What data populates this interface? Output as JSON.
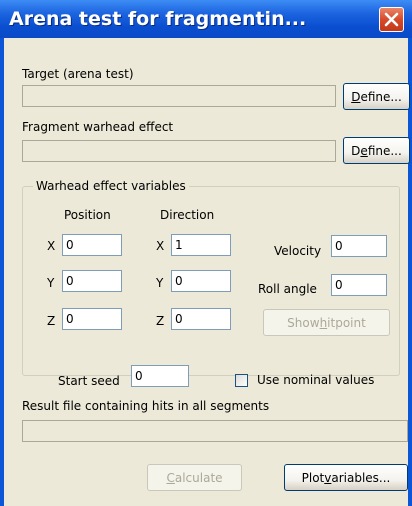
{
  "window": {
    "title": "Arena test for fragmentin...",
    "close_icon": "close-icon"
  },
  "target": {
    "label": "Target (arena test)",
    "value": "",
    "define_button": {
      "prefix": "",
      "mnemonic": "D",
      "suffix": "efine..."
    }
  },
  "fragment": {
    "label": "Fragment warhead effect",
    "value": "",
    "define_button": {
      "prefix": "D",
      "mnemonic": "e",
      "suffix": "fine..."
    }
  },
  "warhead_group": {
    "title": "Warhead effect variables",
    "position": {
      "header": "Position",
      "x_label": "X",
      "x_value": "0",
      "y_label": "Y",
      "y_value": "0",
      "z_label": "Z",
      "z_value": "0"
    },
    "direction": {
      "header": "Direction",
      "x_label": "X",
      "x_value": "1",
      "y_label": "Y",
      "y_value": "0",
      "z_label": "Z",
      "z_value": "0"
    },
    "velocity": {
      "label": "Velocity",
      "value": "0"
    },
    "roll_angle": {
      "label": "Roll angle",
      "value": "0"
    },
    "show_hitpoint": {
      "prefix": "Show ",
      "mnemonic": "h",
      "suffix": "itpoint",
      "enabled": false
    }
  },
  "start_seed": {
    "label": "Start seed",
    "value": "0"
  },
  "nominal": {
    "label": "Use nominal values",
    "checked": false
  },
  "result_file": {
    "label": "Result file containing hits in all segments",
    "value": ""
  },
  "calculate_button": {
    "prefix": "",
    "mnemonic": "C",
    "suffix": "alculate",
    "enabled": false
  },
  "plot_button": {
    "prefix": "Plot ",
    "mnemonic": "v",
    "suffix": "ariables..."
  },
  "colors": {
    "titlebar": "#0a56d6",
    "face": "#ece9d8",
    "close": "#d74a2a"
  }
}
